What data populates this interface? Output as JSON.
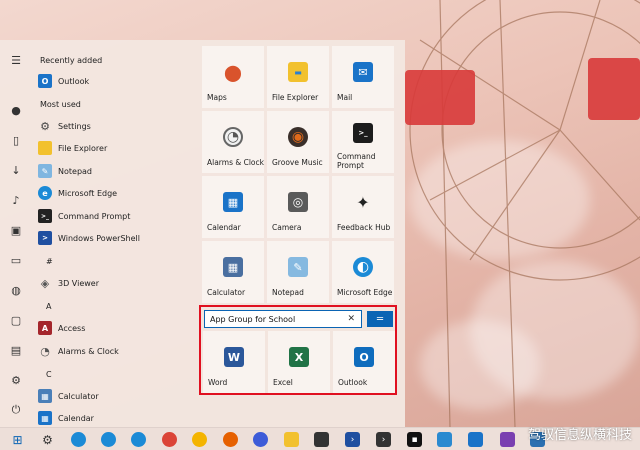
{
  "app_list": {
    "recently_added_header": "Recently added",
    "recently_added": [
      {
        "label": "Outlook",
        "icon": "outlook-icon",
        "color": "#1a73c8"
      }
    ],
    "most_used_header": "Most used",
    "most_used": [
      {
        "label": "Settings",
        "icon": "gear-icon",
        "color": "#444444"
      },
      {
        "label": "File Explorer",
        "icon": "folder-icon",
        "color": "#f2c12e"
      },
      {
        "label": "Notepad",
        "icon": "notepad-icon",
        "color": "#7fb6e0"
      },
      {
        "label": "Microsoft Edge",
        "icon": "edge-icon",
        "color": "#1b8ad6"
      },
      {
        "label": "Command Prompt",
        "icon": "terminal-icon",
        "color": "#222222"
      },
      {
        "label": "Windows PowerShell",
        "icon": "powershell-icon",
        "color": "#1f4fa0"
      }
    ],
    "hash_header": "#",
    "hash_apps": [
      {
        "label": "3D Viewer",
        "icon": "cube-icon",
        "color": "#555555"
      }
    ],
    "a_header": "A",
    "a_apps": [
      {
        "label": "Access",
        "icon": "access-icon",
        "color": "#a4262c"
      },
      {
        "label": "Alarms & Clock",
        "icon": "clock-icon",
        "color": "#666666"
      }
    ],
    "c_header": "C",
    "c_apps": [
      {
        "label": "Calculator",
        "icon": "calculator-icon",
        "color": "#4a7fb8"
      },
      {
        "label": "Calendar",
        "icon": "calendar-icon",
        "color": "#1a73c8"
      }
    ]
  },
  "tiles": [
    {
      "label": "Maps",
      "icon": "map-pin-icon",
      "color": "#d9532c",
      "glyph": "⬤"
    },
    {
      "label": "File Explorer",
      "icon": "folder-icon",
      "color": "#f2c12e",
      "glyph": "▬"
    },
    {
      "label": "Mail",
      "icon": "mail-icon",
      "color": "#1a73c8",
      "glyph": "✉"
    },
    {
      "label": "Alarms & Clock",
      "icon": "clock-icon",
      "color": "#6a6a6a",
      "glyph": "◔"
    },
    {
      "label": "Groove Music",
      "icon": "music-icon",
      "color": "#e06a1b",
      "glyph": "◉"
    },
    {
      "label": "Command\nPrompt",
      "icon": "terminal-icon",
      "color": "#1c1c1c",
      "glyph": ">_"
    },
    {
      "label": "Calendar",
      "icon": "calendar-icon",
      "color": "#1a73c8",
      "glyph": "▦"
    },
    {
      "label": "Camera",
      "icon": "camera-icon",
      "color": "#5a5a5a",
      "glyph": "◎"
    },
    {
      "label": "Feedback Hub",
      "icon": "feedback-icon",
      "color": "#222222",
      "glyph": "✦"
    },
    {
      "label": "Calculator",
      "icon": "calculator-icon",
      "color": "#4a6fa0",
      "glyph": "▦"
    },
    {
      "label": "Notepad",
      "icon": "notepad-icon",
      "color": "#86b9e0",
      "glyph": "✎"
    },
    {
      "label": "Microsoft Edge",
      "icon": "edge-icon",
      "color": "#1b8ad6",
      "glyph": "◐"
    }
  ],
  "group": {
    "name_value": "App Group for School",
    "clear_glyph": "✕",
    "toggle_glyph": "═",
    "apps": [
      {
        "label": "Word",
        "icon": "word-icon",
        "color": "#2b579a",
        "glyph": "W"
      },
      {
        "label": "Excel",
        "icon": "excel-icon",
        "color": "#217346",
        "glyph": "X"
      },
      {
        "label": "Outlook",
        "icon": "outlook-icon",
        "color": "#0f6cbd",
        "glyph": "O"
      }
    ],
    "border_color": "#e01020"
  },
  "watermark": "驾驭信息纵横科技",
  "colors": {
    "accent": "#0a64b4"
  }
}
